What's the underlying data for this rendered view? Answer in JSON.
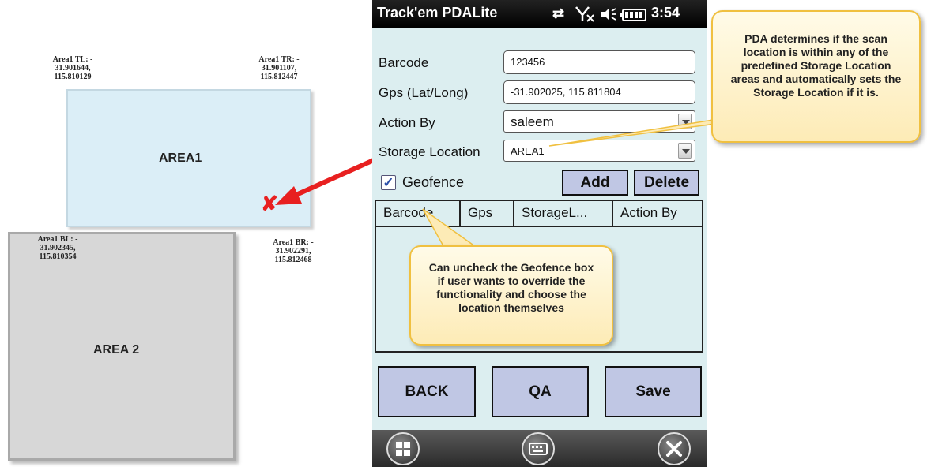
{
  "diagram": {
    "area1": {
      "label": "AREA1",
      "tl": {
        "title": "Area1 TL: -",
        "lat": "31.901644,",
        "lng": "115.810129"
      },
      "tr": {
        "title": "Area1 TR:  -",
        "lat": "31.901107,",
        "lng": "115.812447"
      },
      "bl": {
        "title": "Area1 BL: -",
        "lat": "31.902345,",
        "lng": "115.810354"
      },
      "br": {
        "title": "Area1 BR: -",
        "lat": "31.902291,",
        "lng": "115.812468"
      }
    },
    "area2": {
      "label": "AREA 2"
    },
    "marker": "✘",
    "colors": {
      "area1_fill": "#dbeef7",
      "area2_fill": "#d7d7d7",
      "arrow": "#e82020"
    }
  },
  "phone": {
    "status_bar": {
      "title": "Track'em PDALite",
      "time": "3:54",
      "icons": [
        "sync-icon",
        "no-signal-icon",
        "volume-icon",
        "battery-icon"
      ]
    },
    "form": {
      "barcode_label": "Barcode",
      "barcode_value": "123456",
      "gps_label": "Gps (Lat/Long)",
      "gps_value": "-31.902025, 115.811804",
      "action_by_label": "Action By",
      "action_by_value": "saleem",
      "storage_label": "Storage Location",
      "storage_value": "AREA1"
    },
    "geofence": {
      "label": "Geofence",
      "checked": true
    },
    "buttons": {
      "add": "Add",
      "delete": "Delete",
      "back": "BACK",
      "qa": "QA",
      "save": "Save"
    },
    "grid": {
      "columns": [
        "Barcode",
        "Gps",
        "StorageL...",
        "Action By"
      ]
    },
    "bottom_bar": {
      "icons": [
        "windows-start-icon",
        "keyboard-icon",
        "close-icon"
      ]
    }
  },
  "callouts": {
    "pda": "PDA determines if the scan location is within any of the predefined Storage Location areas and automatically sets the Storage Location if it is.",
    "geofence": "Can uncheck the Geofence box if user wants to override the functionality and choose the location themselves"
  }
}
